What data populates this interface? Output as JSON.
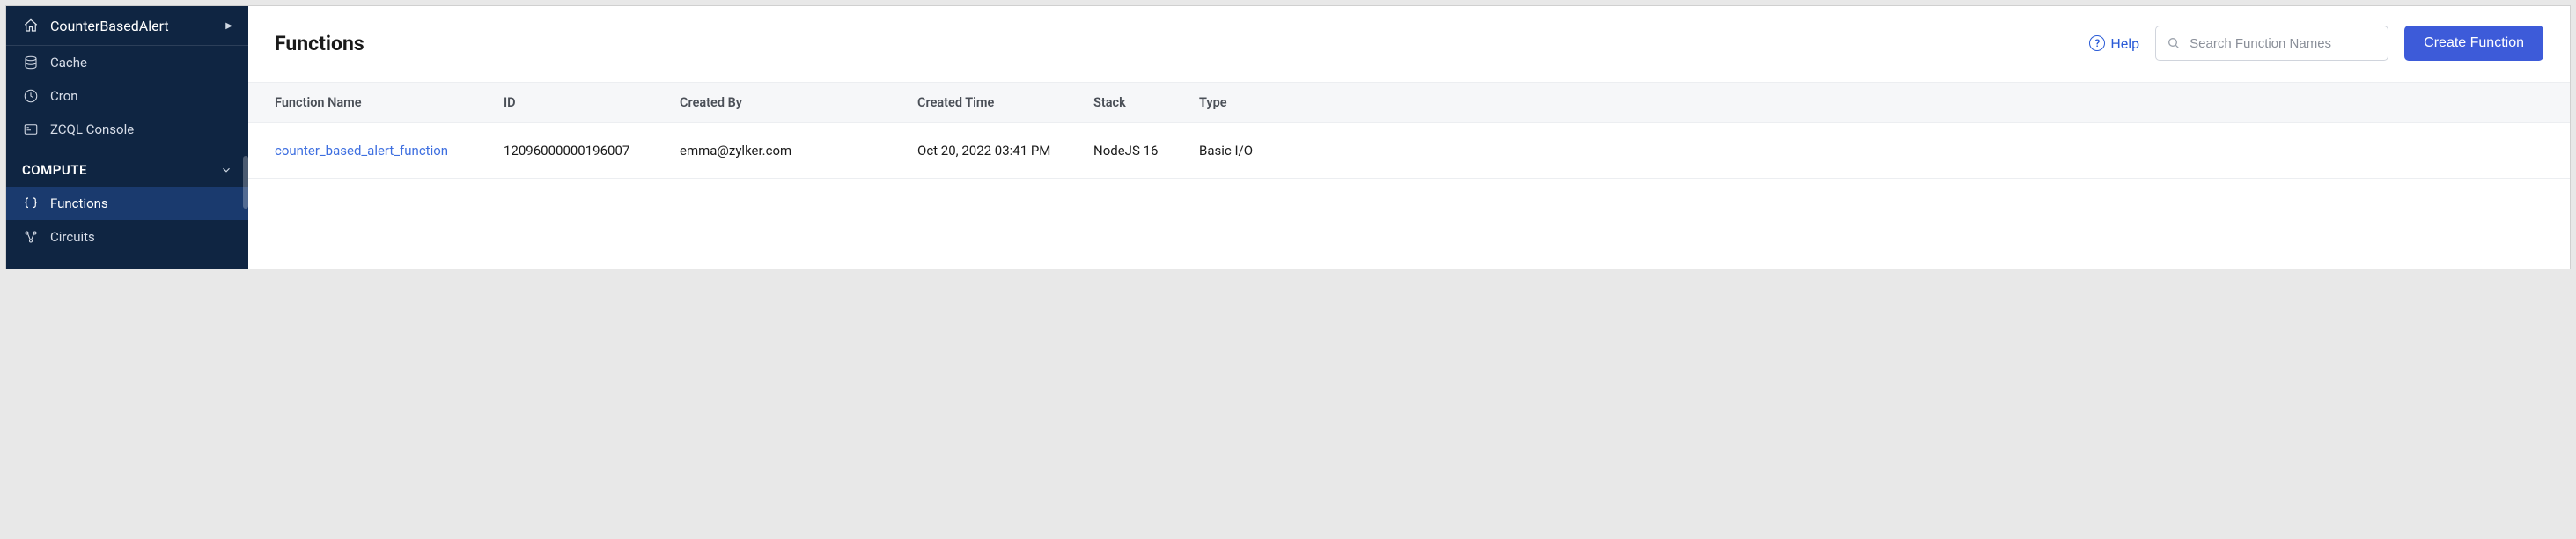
{
  "project": {
    "name": "CounterBasedAlert"
  },
  "sidebar": {
    "items": [
      {
        "label": "Cache"
      },
      {
        "label": "Cron"
      },
      {
        "label": "ZCQL Console"
      }
    ],
    "section": {
      "label": "COMPUTE"
    },
    "compute_items": [
      {
        "label": "Functions"
      },
      {
        "label": "Circuits"
      }
    ]
  },
  "header": {
    "title": "Functions",
    "help_label": "Help",
    "search_placeholder": "Search Function Names",
    "create_label": "Create Function"
  },
  "table": {
    "columns": {
      "name": "Function Name",
      "id": "ID",
      "by": "Created By",
      "time": "Created Time",
      "stack": "Stack",
      "type": "Type"
    },
    "rows": [
      {
        "name": "counter_based_alert_function",
        "id": "12096000000196007",
        "by": "emma@zylker.com",
        "time": "Oct 20, 2022 03:41 PM",
        "stack": "NodeJS 16",
        "type": "Basic I/O"
      }
    ]
  }
}
